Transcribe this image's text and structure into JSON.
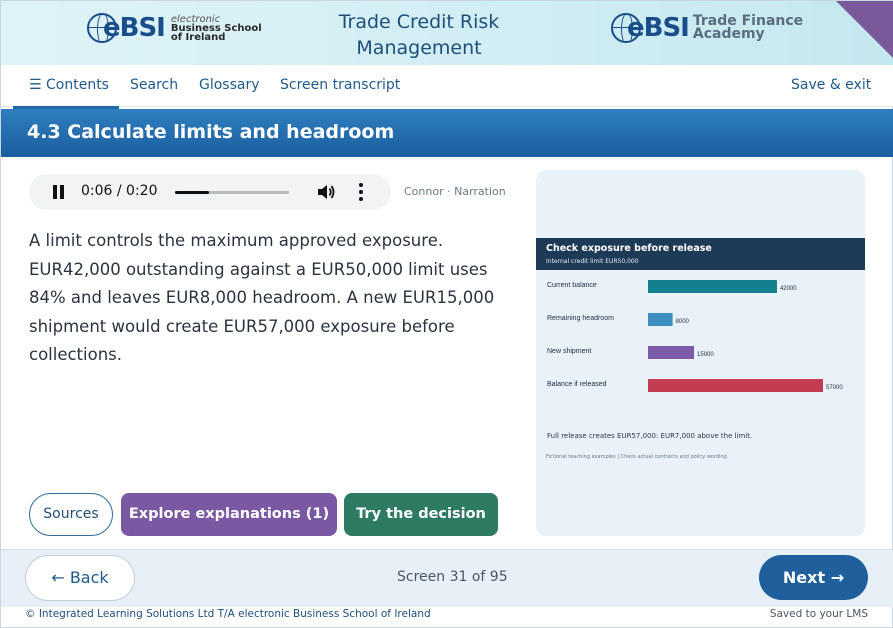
{
  "header": {
    "course_title": "Trade Credit Risk Management",
    "logo_left": {
      "mark": "eBSI",
      "line1": "electronic",
      "line2": "Business School",
      "line3": "of Ireland"
    },
    "logo_right": {
      "mark": "eBSI",
      "line1": "Trade Finance",
      "line2": "Academy"
    }
  },
  "nav": {
    "contents": "☰ Contents",
    "search": "Search",
    "glossary": "Glossary",
    "transcript": "Screen transcript",
    "save_exit": "Save & exit"
  },
  "section": {
    "title": "4.3 Calculate limits and headroom"
  },
  "audio": {
    "time": "0:06 / 0:20",
    "progress_fraction": 0.3,
    "narrator": "Connor · Narration"
  },
  "body_text": "A limit controls the maximum approved exposure. EUR42,000 outstanding against a EUR50,000 limit uses 84% and leaves EUR8,000 headroom. A new EUR15,000 shipment would create EUR57,000 exposure before collections.",
  "chart_data": {
    "type": "bar",
    "orientation": "horizontal",
    "title": "Check exposure before release",
    "subtitle": "Internal credit limit EUR50,000",
    "categories": [
      "Current balance",
      "Remaining headroom",
      "New shipment",
      "Balance if released"
    ],
    "values": [
      42000,
      8000,
      15000,
      57000
    ],
    "value_labels": [
      "42000",
      "8000",
      "15000",
      "57000"
    ],
    "colors": [
      "#12808d",
      "#3a8fc0",
      "#7c5ca8",
      "#c23c52"
    ],
    "xlim": [
      0,
      60000
    ],
    "note": "Full release creates EUR57,000: EUR7,000 above the limit.",
    "footnote": "Fictional teaching examples | Check actual contracts and policy wording"
  },
  "actions": {
    "sources": "Sources",
    "explore": "Explore explanations (1)",
    "try": "Try the decision"
  },
  "footer": {
    "back": "← Back",
    "screen": "Screen 31 of 95",
    "next": "Next →",
    "copyright": "© Integrated Learning Solutions Ltd T/A electronic Business School of Ireland",
    "saved": "Saved to your LMS"
  },
  "colors": {
    "accent": "#1e5f9c",
    "section_bar": "#1b5e9e",
    "explore": "#7a58a2",
    "try": "#2f7a63",
    "corner": "#7a5a9a"
  }
}
